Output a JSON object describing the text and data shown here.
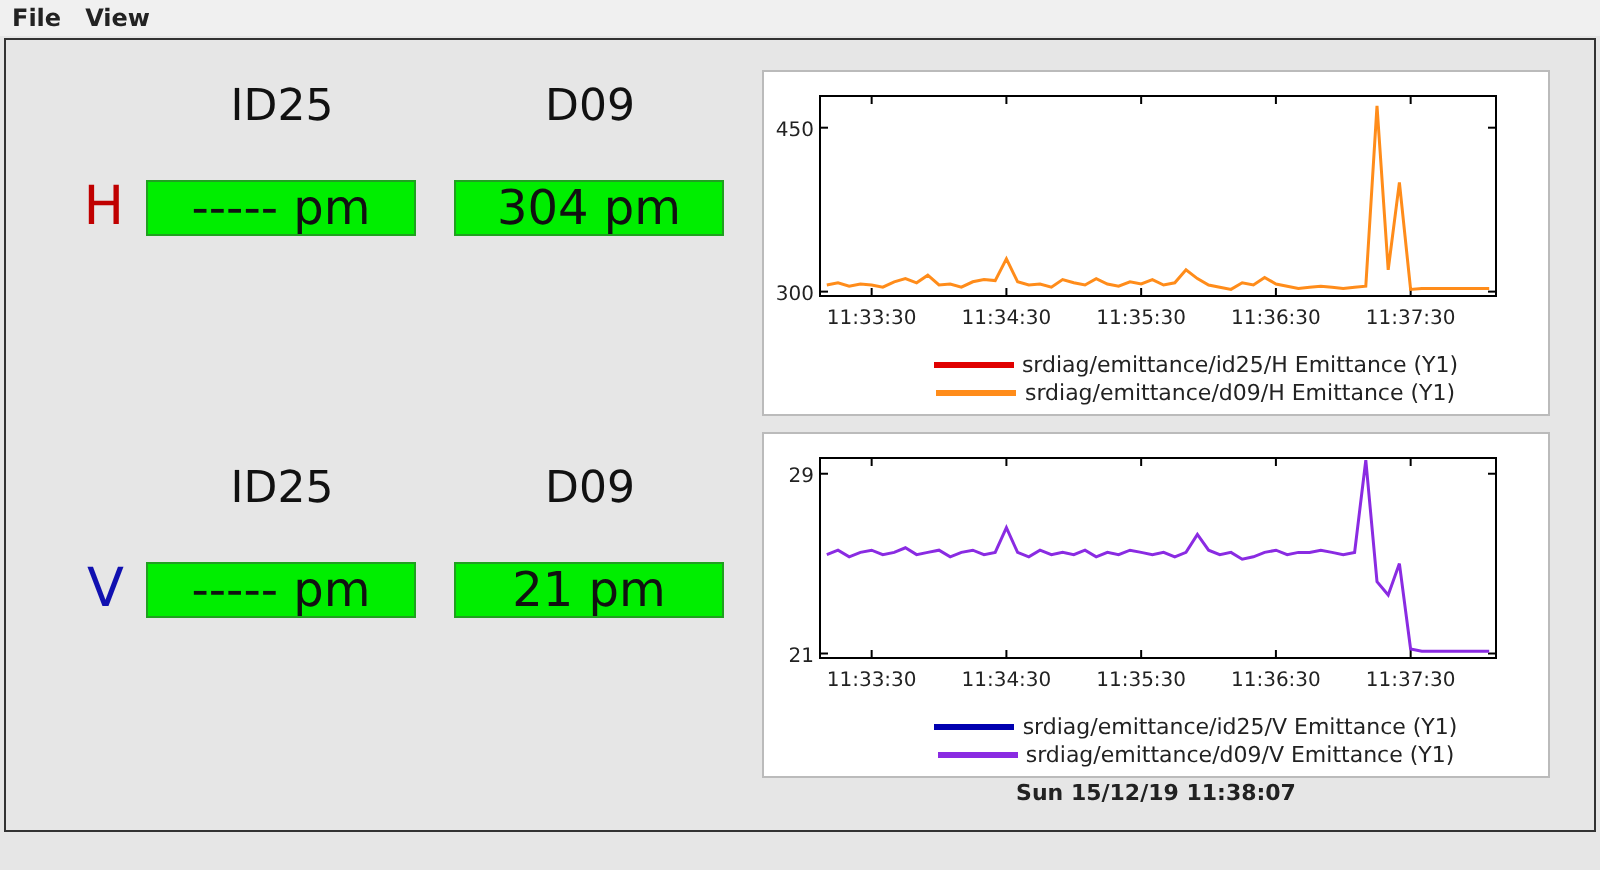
{
  "menu": [
    "File",
    "View"
  ],
  "rows": [
    {
      "label": "H",
      "color": "#c00000",
      "columns": [
        "ID25",
        "D09"
      ],
      "values": [
        "----- pm",
        "304 pm"
      ],
      "chart_data": {
        "type": "line",
        "x": [
          41590,
          41595,
          41600,
          41605,
          41610,
          41615,
          41620,
          41625,
          41630,
          41635,
          41640,
          41645,
          41650,
          41655,
          41660,
          41665,
          41670,
          41675,
          41680,
          41685,
          41690,
          41695,
          41700,
          41705,
          41710,
          41715,
          41720,
          41725,
          41730,
          41735,
          41740,
          41745,
          41750,
          41755,
          41760,
          41765,
          41770,
          41775,
          41780,
          41785,
          41790,
          41795,
          41800,
          41805,
          41810,
          41815,
          41820,
          41825,
          41830,
          41835,
          41840,
          41845,
          41850,
          41855,
          41860,
          41865,
          41870,
          41875,
          41880,
          41885
        ],
        "xlim": [
          41587,
          41888
        ],
        "ylim": [
          296,
          479
        ],
        "xticks": [
          {
            "value": 41610,
            "label": "11:33:30"
          },
          {
            "value": 41670,
            "label": "11:34:30"
          },
          {
            "value": 41730,
            "label": "11:35:30"
          },
          {
            "value": 41790,
            "label": "11:36:30"
          },
          {
            "value": 41850,
            "label": "11:37:30"
          }
        ],
        "yticks": [
          300,
          450
        ],
        "series": [
          {
            "name": "srdiag/emittance/id25/H Emittance (Y1)",
            "color": "#e00000",
            "values": [
              null,
              null,
              null,
              null,
              null,
              null,
              null,
              null,
              null,
              null,
              null,
              null,
              null,
              null,
              null,
              null,
              null,
              null,
              null,
              null,
              null,
              null,
              null,
              null,
              null,
              null,
              null,
              null,
              null,
              null,
              null,
              null,
              null,
              null,
              null,
              null,
              null,
              null,
              null,
              null,
              null,
              null,
              null,
              null,
              null,
              null,
              null,
              null,
              null,
              null,
              null,
              null,
              null,
              null,
              null,
              null,
              null,
              null,
              null,
              null
            ]
          },
          {
            "name": "srdiag/emittance/d09/H Emittance (Y1)",
            "color": "#ff8c1a",
            "values": [
              306,
              308,
              305,
              307,
              306,
              304,
              309,
              312,
              308,
              315,
              306,
              307,
              304,
              309,
              311,
              310,
              330,
              309,
              306,
              307,
              304,
              311,
              308,
              306,
              312,
              307,
              305,
              309,
              307,
              311,
              306,
              308,
              320,
              312,
              306,
              304,
              302,
              308,
              306,
              313,
              307,
              305,
              303,
              304,
              305,
              304,
              303,
              304,
              305,
              470,
              320,
              400,
              302,
              303,
              303,
              303,
              303,
              303,
              303,
              303
            ]
          }
        ]
      }
    },
    {
      "label": "V",
      "color": "#1010b0",
      "columns": [
        "ID25",
        "D09"
      ],
      "values": [
        "----- pm",
        "21 pm"
      ],
      "chart_data": {
        "type": "line",
        "x": [
          41590,
          41595,
          41600,
          41605,
          41610,
          41615,
          41620,
          41625,
          41630,
          41635,
          41640,
          41645,
          41650,
          41655,
          41660,
          41665,
          41670,
          41675,
          41680,
          41685,
          41690,
          41695,
          41700,
          41705,
          41710,
          41715,
          41720,
          41725,
          41730,
          41735,
          41740,
          41745,
          41750,
          41755,
          41760,
          41765,
          41770,
          41775,
          41780,
          41785,
          41790,
          41795,
          41800,
          41805,
          41810,
          41815,
          41820,
          41825,
          41830,
          41835,
          41840,
          41845,
          41850,
          41855,
          41860,
          41865,
          41870,
          41875,
          41880,
          41885
        ],
        "xlim": [
          41587,
          41888
        ],
        "ylim": [
          20.8,
          29.7
        ],
        "xticks": [
          {
            "value": 41610,
            "label": "11:33:30"
          },
          {
            "value": 41670,
            "label": "11:34:30"
          },
          {
            "value": 41730,
            "label": "11:35:30"
          },
          {
            "value": 41790,
            "label": "11:36:30"
          },
          {
            "value": 41850,
            "label": "11:37:30"
          }
        ],
        "yticks": [
          21,
          29
        ],
        "series": [
          {
            "name": "srdiag/emittance/id25/V Emittance (Y1)",
            "color": "#0000b0",
            "values": [
              null,
              null,
              null,
              null,
              null,
              null,
              null,
              null,
              null,
              null,
              null,
              null,
              null,
              null,
              null,
              null,
              null,
              null,
              null,
              null,
              null,
              null,
              null,
              null,
              null,
              null,
              null,
              null,
              null,
              null,
              null,
              null,
              null,
              null,
              null,
              null,
              null,
              null,
              null,
              null,
              null,
              null,
              null,
              null,
              null,
              null,
              null,
              null,
              null,
              null,
              null,
              null,
              null,
              null,
              null,
              null,
              null,
              null,
              null,
              null
            ]
          },
          {
            "name": "srdiag/emittance/d09/V Emittance (Y1)",
            "color": "#8a2be2",
            "values": [
              25.4,
              25.6,
              25.3,
              25.5,
              25.6,
              25.4,
              25.5,
              25.7,
              25.4,
              25.5,
              25.6,
              25.3,
              25.5,
              25.6,
              25.4,
              25.5,
              26.6,
              25.5,
              25.3,
              25.6,
              25.4,
              25.5,
              25.4,
              25.6,
              25.3,
              25.5,
              25.4,
              25.6,
              25.5,
              25.4,
              25.5,
              25.3,
              25.5,
              26.3,
              25.6,
              25.4,
              25.5,
              25.2,
              25.3,
              25.5,
              25.6,
              25.4,
              25.5,
              25.5,
              25.6,
              25.5,
              25.4,
              25.5,
              29.6,
              24.2,
              23.6,
              25.0,
              21.2,
              21.1,
              21.1,
              21.1,
              21.1,
              21.1,
              21.1,
              21.1
            ]
          }
        ]
      }
    }
  ],
  "status": "Sun 15/12/19 11:38:07"
}
